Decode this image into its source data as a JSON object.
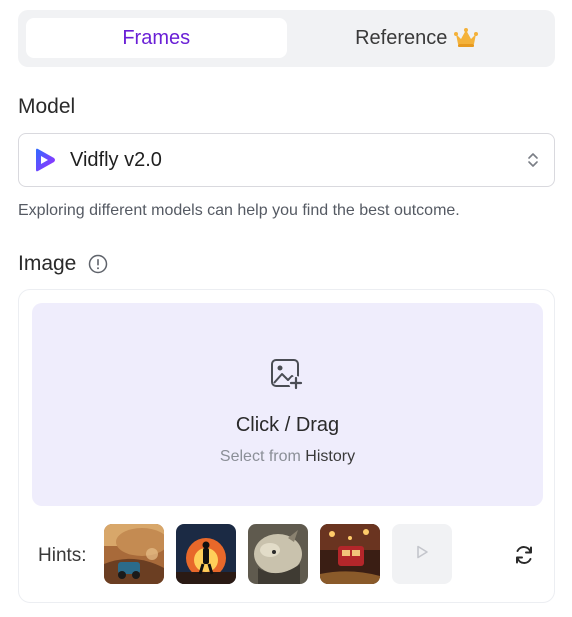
{
  "tabs": [
    {
      "label": "Frames",
      "active": true
    },
    {
      "label": "Reference",
      "active": false,
      "badge_icon": "crown-icon"
    }
  ],
  "model": {
    "title": "Model",
    "selected": "Vidfly v2.0",
    "brand_icon": "vidfly-logo-icon",
    "helper_text": "Exploring different models can help you find the best outcome."
  },
  "image": {
    "title": "Image",
    "info_icon": "info-icon",
    "upload": {
      "main_text": "Click / Drag",
      "sub_prefix": "Select from",
      "sub_link": "History"
    },
    "hints": {
      "label": "Hints:",
      "items": [
        "hint-thumbnail-car-desert",
        "hint-thumbnail-runner-explosion",
        "hint-thumbnail-monster-creature",
        "hint-thumbnail-tram-street"
      ]
    }
  },
  "colors": {
    "accent": "#6a1fd6",
    "drop_bg": "#efedfc",
    "tab_bg": "#f1f2f4"
  }
}
